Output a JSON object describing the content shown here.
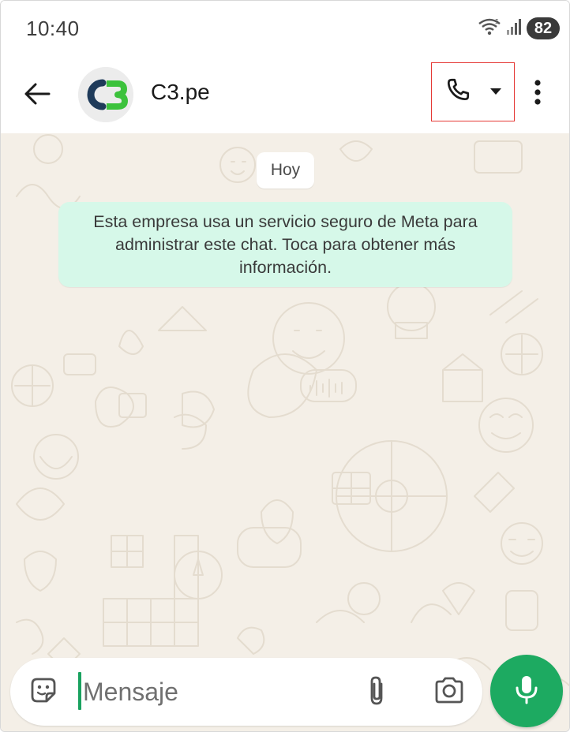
{
  "status_bar": {
    "time": "10:40",
    "battery": "82",
    "icons": [
      "wifi-icon",
      "signal-icon",
      "battery-icon"
    ]
  },
  "header": {
    "contact_name": "C3.pe",
    "avatar_text": "C3",
    "icons": [
      "back-arrow-icon",
      "phone-icon",
      "caret-down-icon",
      "more-vertical-icon"
    ]
  },
  "chat": {
    "date_label": "Hoy",
    "system_message": "Esta empresa usa un servicio seguro de Meta para administrar este chat. Toca para obtener más información."
  },
  "composer": {
    "placeholder": "Mensaje",
    "icons": [
      "sticker-icon",
      "paperclip-icon",
      "camera-icon",
      "microphone-icon"
    ]
  },
  "colors": {
    "accent": "#1daa61",
    "chat_background": "#f4efe7",
    "system_bubble": "#d6f8e9",
    "highlight_border": "#e53935",
    "avatar_dark": "#1f3b5a",
    "avatar_green": "#3cc23c"
  }
}
